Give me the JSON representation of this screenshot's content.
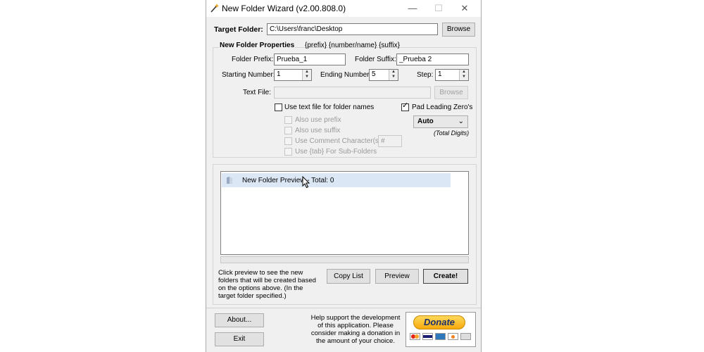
{
  "window": {
    "title": "New Folder Wizard  (v2.00.808.0)",
    "controls": {
      "minimize": "—",
      "maximize": "☐",
      "close": "✕"
    }
  },
  "target": {
    "label": "Target Folder:",
    "value": "C:\\Users\\franc\\Desktop",
    "browse_label": "Browse"
  },
  "props": {
    "heading": "New Folder Properties",
    "pattern_hint": "{prefix} {number/name} {suffix}",
    "prefix_label": "Folder Prefix:",
    "prefix_value": "Prueba_1",
    "suffix_label": "Folder Suffix:",
    "suffix_value": "_Prueba 2",
    "start_label": "Starting Number:",
    "start_value": "1",
    "end_label": "Ending Number:",
    "end_value": "5",
    "step_label": "Step:",
    "step_value": "1",
    "textfile_label": "Text File:",
    "textfile_value": "",
    "textfile_browse_label": "Browse",
    "use_text_file_label": "Use text file for folder names",
    "pad_label": "Pad Leading Zero's",
    "pad_checked": true,
    "also_prefix_label": "Also use prefix",
    "also_suffix_label": "Also use suffix",
    "comment_label": "Use Comment Character(s):",
    "comment_value": "#",
    "tab_label": "Use {tab} For Sub-Folders",
    "digits_value": "Auto",
    "digits_caption": "(Total Digits)"
  },
  "preview": {
    "row_text": "New Folder Preview - Total: 0",
    "hint": "Click preview to see the new folders that will be created based on the options above. (In the target folder specified.)",
    "copy_label": "Copy List",
    "preview_label": "Preview",
    "create_label": "Create!"
  },
  "footer": {
    "about_label": "About...",
    "exit_label": "Exit",
    "support_text": "Help support the development of this application. Please consider making a donation in the amount of your choice.",
    "donate_label": "Donate",
    "cards": [
      "MC",
      "VISA",
      "AMEX",
      "DISC",
      "BANK"
    ]
  },
  "colors": {
    "window_bg": "#f0f0f0",
    "selection": "#dce7f5",
    "donate_gold": "#f6a90c"
  }
}
